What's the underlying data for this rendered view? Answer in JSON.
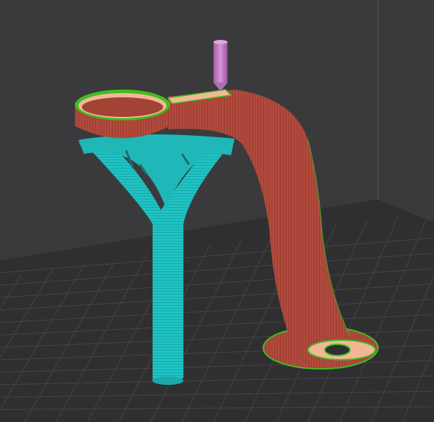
{
  "viewport": {
    "background_color": "#3a3a3c",
    "floor_color": "#2f2f31",
    "grid_color": "#4a4a4c"
  },
  "model": {
    "perimeter_color": "#b04a3c",
    "top_infill_color": "#f2b896",
    "edge_color": "#3fbf1f",
    "support_color": "#1fc3c3",
    "nozzle_color": "#c87ec8"
  }
}
